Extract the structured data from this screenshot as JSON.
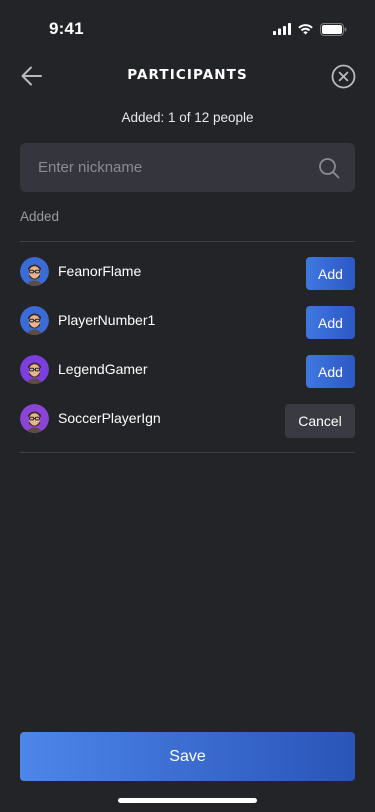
{
  "status_bar": {
    "time": "9:41"
  },
  "header": {
    "title": "PARTICIPANTS",
    "back_icon": "arrow-left-icon",
    "close_icon": "close-circle-icon"
  },
  "subtitle": "Added: 1 of 12 people",
  "search": {
    "placeholder": "Enter nickname",
    "value": "",
    "icon": "search-icon"
  },
  "section_label": "Added",
  "participants": [
    {
      "name": "FeanorFlame",
      "action": "Add",
      "avatar_color": "#3b6bd6"
    },
    {
      "name": "PlayerNumber1",
      "action": "Add",
      "avatar_color": "#3b6bd6"
    },
    {
      "name": "LegendGamer",
      "action": "Add",
      "avatar_color": "#7b3fe0"
    },
    {
      "name": "SoccerPlayerIgn",
      "action": "Cancel",
      "avatar_color": "#8a45d6"
    }
  ],
  "save_label": "Save",
  "colors": {
    "background": "#232428",
    "search_bg": "#35363d",
    "accent": "#3f77e0",
    "cancel_bg": "#3a3b42"
  }
}
